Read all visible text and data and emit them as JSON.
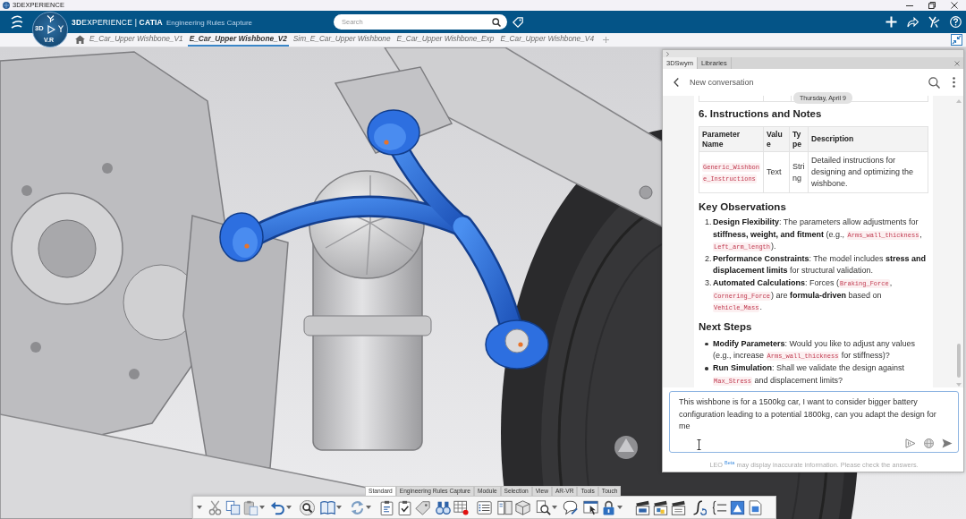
{
  "title_bar": {
    "title": "3DEXPERIENCE"
  },
  "header": {
    "compass": {
      "left_label": "3D",
      "bottom_label": "V.R"
    },
    "brand": "**3D**EXPERIENCE | **CATIA**",
    "app_name": "Engineering Rules Capture",
    "search": {
      "placeholder": "Search"
    }
  },
  "document_tabs": [
    {
      "label": "E_Car_Upper Wishbone_V1",
      "selected": false
    },
    {
      "label": "E_Car_Upper Wishbone_V2",
      "selected": true
    },
    {
      "label": "Sim_E_Car_Upper Wishbone",
      "selected": false
    },
    {
      "label": "E_Car_Upper Wishbone_Exp",
      "selected": false
    },
    {
      "label": "E_Car_Upper Wishbone_V4",
      "selected": false
    }
  ],
  "assistant_panel": {
    "tabs": [
      {
        "label": "3DSwym",
        "selected": true
      },
      {
        "label": "Libraries",
        "selected": false
      }
    ],
    "title": "New conversation",
    "date_badge": "Thursday, April 9",
    "sections": [
      {
        "kind": "heading",
        "text": "6. Instructions and Notes"
      },
      {
        "kind": "table",
        "columns": [
          "Parameter Name",
          "Value",
          "Type",
          "Description"
        ],
        "rows": [
          [
            {
              "kind": "code",
              "text": "Generic_Wishbone_Instructions"
            },
            {
              "kind": "text",
              "text": "Text"
            },
            {
              "kind": "text",
              "text": "String"
            },
            {
              "kind": "text",
              "text": "Detailed instructions for designing and optimizing the wishbone."
            }
          ]
        ]
      },
      {
        "kind": "heading",
        "text": "Key Observations"
      },
      {
        "kind": "ordered_list",
        "items": [
          {
            "number": "1.",
            "segments": [
              {
                "kind": "text",
                "text": "**Design Flexibility**: The parameters allow adjustments for **stiffness, weight, and fitment** (e.g., "
              },
              {
                "kind": "code",
                "text": "Arms_wall_thickness"
              },
              {
                "kind": "text",
                "text": ", "
              },
              {
                "kind": "code",
                "text": "Left_arm_length"
              },
              {
                "kind": "text",
                "text": ")."
              }
            ]
          },
          {
            "number": "2.",
            "segments": [
              {
                "kind": "text",
                "text": "**Performance Constraints**: The model includes **stress and displacement limits** for structural validation."
              }
            ]
          },
          {
            "number": "3.",
            "segments": [
              {
                "kind": "text",
                "text": "**Automated Calculations**: Forces ("
              },
              {
                "kind": "code",
                "text": "Braking_Force"
              },
              {
                "kind": "text",
                "text": ", "
              },
              {
                "kind": "code",
                "text": "Cornering_Force"
              },
              {
                "kind": "text",
                "text": ") are **formula-driven** based on "
              },
              {
                "kind": "code",
                "text": "Vehicle_Mass"
              },
              {
                "kind": "text",
                "text": "."
              }
            ]
          }
        ]
      },
      {
        "kind": "heading",
        "text": "Next Steps"
      },
      {
        "kind": "bullet_list",
        "items": [
          {
            "segments": [
              {
                "kind": "text",
                "text": "**Modify Parameters**: Would you like to adjust any values (e.g., increase "
              },
              {
                "kind": "code",
                "text": "Arms_wall_thickness"
              },
              {
                "kind": "text",
                "text": " for stiffness)?"
              }
            ]
          },
          {
            "segments": [
              {
                "kind": "text",
                "text": "**Run Simulation**: Shall we validate the design against "
              },
              {
                "kind": "code",
                "text": "Max_Stress"
              },
              {
                "kind": "text",
                "text": " and displacement limits?"
              }
            ]
          }
        ]
      }
    ],
    "input": {
      "value": "This wishbone is for a 1500kg car, I want to consider bigger battery configuration leading to a potential 1800kg, can you adapt the design for me"
    },
    "disclaimer": "LEO $^{Beta}$ may display inaccurate information. Please check the answers."
  },
  "toolbar": {
    "tabs": [
      {
        "label": "Standard",
        "selected": true
      },
      {
        "label": "Engineering Rules Capture",
        "selected": false
      },
      {
        "label": "Module",
        "selected": false
      },
      {
        "label": "Selection",
        "selected": false
      },
      {
        "label": "View",
        "selected": false
      },
      {
        "label": "AR-VR",
        "selected": false
      },
      {
        "label": "Tools",
        "selected": false
      },
      {
        "label": "Touch",
        "selected": false
      }
    ]
  }
}
